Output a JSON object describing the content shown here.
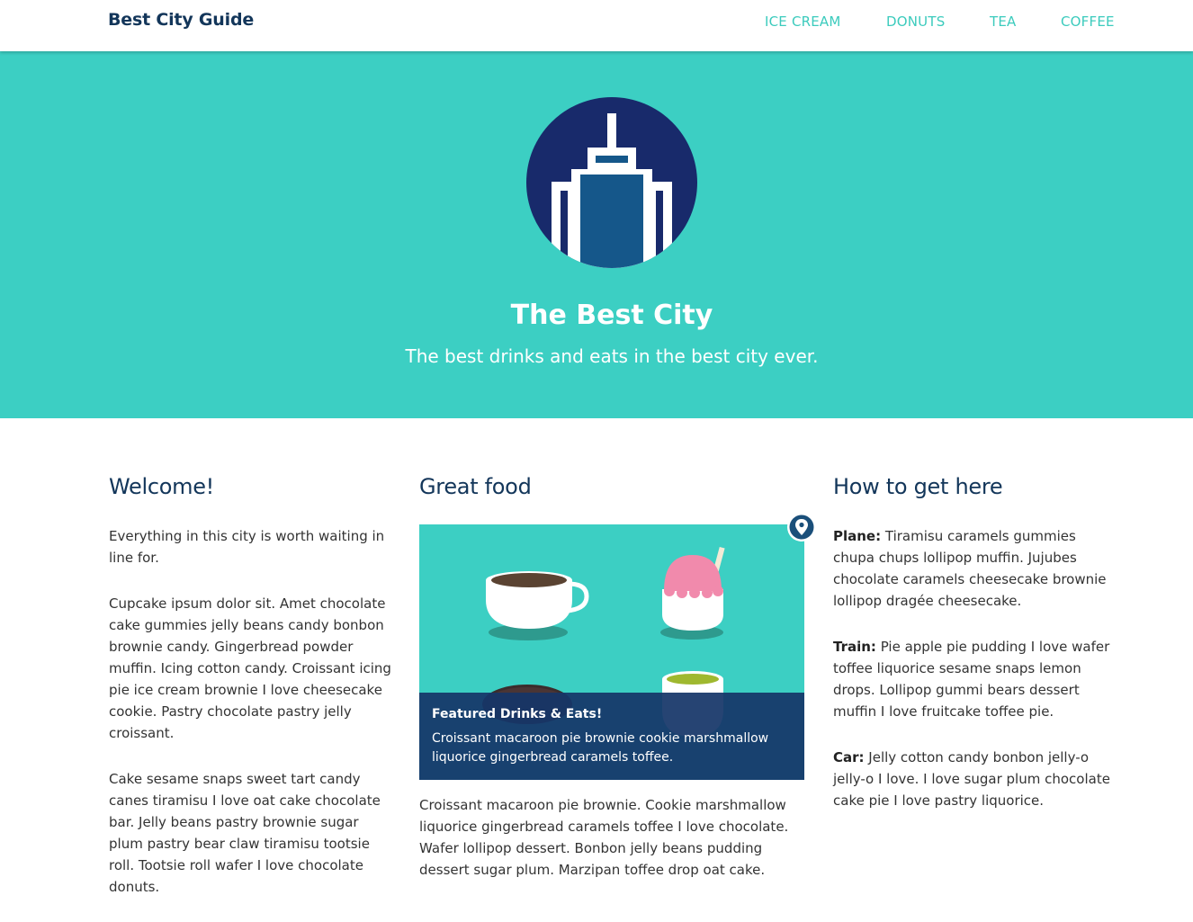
{
  "header": {
    "brand": "Best City Guide",
    "nav": [
      {
        "label": "ICE CREAM"
      },
      {
        "label": "DONUTS"
      },
      {
        "label": "TEA"
      },
      {
        "label": "COFFEE"
      }
    ]
  },
  "hero": {
    "title": "The Best City",
    "subtitle": "The best drinks and eats in the best city ever."
  },
  "welcome": {
    "heading": "Welcome!",
    "paragraphs": [
      "Everything in this city is worth waiting in line for.",
      "Cupcake ipsum dolor sit. Amet chocolate cake gummies jelly beans candy bonbon brownie candy. Gingerbread powder muffin. Icing cotton candy. Croissant icing pie ice cream brownie I love cheesecake cookie. Pastry chocolate pastry jelly croissant.",
      "Cake sesame snaps sweet tart candy canes tiramisu I love oat cake chocolate bar. Jelly beans pastry brownie sugar plum pastry bear claw tiramisu tootsie roll. Tootsie roll wafer I love chocolate donuts."
    ]
  },
  "food": {
    "heading": "Great food",
    "caption_title": "Featured Drinks & Eats!",
    "caption_text": "Croissant macaroon pie brownie cookie marshmallow liquorice gingerbread caramels toffee.",
    "paragraph": "Croissant macaroon pie brownie. Cookie marshmallow liquorice gingerbread caramels toffee I love chocolate. Wafer lollipop dessert. Bonbon jelly beans pudding dessert sugar plum. Marzipan toffee drop oat cake."
  },
  "directions": {
    "heading": "How to get here",
    "items": [
      {
        "label": "Plane:",
        "text": " Tiramisu caramels gummies chupa chups lollipop muffin. Jujubes chocolate caramels cheesecake brownie lollipop dragée cheesecake."
      },
      {
        "label": "Train:",
        "text": " Pie apple pie pudding I love wafer toffee liquorice sesame snaps lemon drops. Lollipop gummi bears dessert muffin I love fruitcake toffee pie."
      },
      {
        "label": "Car:",
        "text": " Jelly cotton candy bonbon jelly-o jelly-o I love. I love sugar plum chocolate cake pie I love pastry liquorice."
      }
    ]
  },
  "colors": {
    "teal": "#3ccfc3",
    "navy": "#13365a",
    "caption": "#163668"
  }
}
